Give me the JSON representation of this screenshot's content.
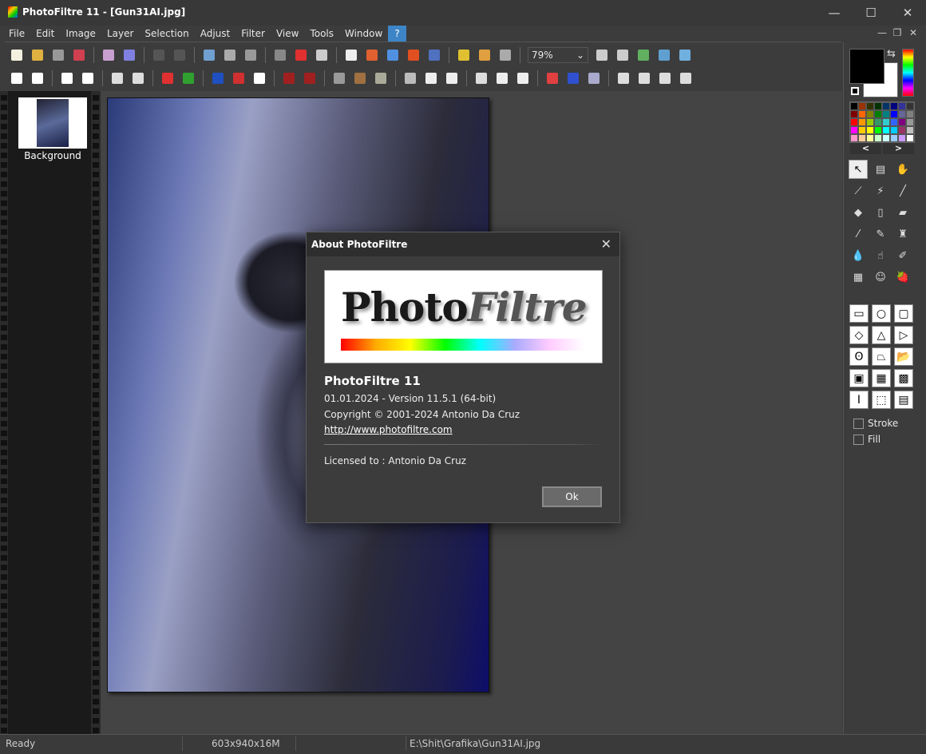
{
  "window": {
    "title": "PhotoFiltre 11 - [Gun31AI.jpg]",
    "minimize": "—",
    "maximize": "☐",
    "close": "✕"
  },
  "menu": [
    "File",
    "Edit",
    "Image",
    "Layer",
    "Selection",
    "Adjust",
    "Filter",
    "View",
    "Tools",
    "Window",
    "?"
  ],
  "mdi_controls": {
    "minimize": "—",
    "restore": "❐",
    "close": "✕"
  },
  "toolbar1": [
    {
      "icon": "new-file-icon",
      "color": "#f4f0e0"
    },
    {
      "icon": "open-folder-icon",
      "color": "#e0b040"
    },
    {
      "icon": "save-icon",
      "color": "#999"
    },
    {
      "icon": "save-as-icon",
      "color": "#d04050"
    },
    "|",
    {
      "icon": "print-icon",
      "color": "#c8a0d0"
    },
    {
      "icon": "scan-icon",
      "color": "#8080e0"
    },
    "|",
    {
      "icon": "undo-icon",
      "color": "#555"
    },
    {
      "icon": "redo-icon",
      "color": "#555"
    },
    "|",
    {
      "icon": "duplicate-image-icon",
      "color": "#70a0d0"
    },
    {
      "icon": "transparent-image-icon",
      "color": "#aaa"
    },
    {
      "icon": "paste-image-icon",
      "color": "#999"
    },
    "|",
    {
      "icon": "gradient-icon",
      "color": "#888"
    },
    {
      "icon": "color-grid-icon",
      "color": "#e03030"
    },
    {
      "icon": "transparency-icon",
      "color": "#ccc"
    },
    "|",
    {
      "icon": "crop-icon",
      "color": "#eee"
    },
    {
      "icon": "frame-icon",
      "color": "#e06030"
    },
    {
      "icon": "selection-icon",
      "color": "#5090e0"
    },
    {
      "icon": "text-icon",
      "color": "#e05020"
    },
    {
      "icon": "resize-icon",
      "color": "#5070c0"
    },
    "|",
    {
      "icon": "image-explorer-icon",
      "color": "#e0c030"
    },
    {
      "icon": "automate-icon",
      "color": "#e0a040"
    },
    {
      "icon": "batch-icon",
      "color": "#aaa"
    }
  ],
  "zoom": {
    "value": "79%",
    "arrow": "⌄"
  },
  "toolbar1b": [
    {
      "icon": "zoom-in-icon",
      "color": "#ccc"
    },
    {
      "icon": "zoom-out-icon",
      "color": "#ccc"
    },
    {
      "icon": "actual-size-icon",
      "color": "#60b060"
    },
    {
      "icon": "fit-window-icon",
      "color": "#60a0d0"
    },
    {
      "icon": "fullscreen-icon",
      "color": "#70b0e0"
    }
  ],
  "toolbar2": [
    {
      "icon": "brightness-minus-icon",
      "color": "#fff"
    },
    {
      "icon": "brightness-plus-icon",
      "color": "#fff"
    },
    "|",
    {
      "icon": "contrast-minus-icon",
      "color": "#fff"
    },
    {
      "icon": "contrast-plus-icon",
      "color": "#fff"
    },
    "|",
    {
      "icon": "gamma-minus-icon",
      "color": "#ddd"
    },
    {
      "icon": "gamma-plus-icon",
      "color": "#ddd"
    },
    "|",
    {
      "icon": "saturation-minus-icon",
      "color": "#e03030"
    },
    {
      "icon": "saturation-plus-icon",
      "color": "#30a030"
    },
    "|",
    {
      "icon": "levels-icon",
      "color": "#2050c0"
    },
    {
      "icon": "color-balance-icon",
      "color": "#d03030"
    },
    {
      "icon": "invert-icon",
      "color": "#fff"
    },
    "|",
    {
      "icon": "auto-gamma-icon",
      "color": "#a02020"
    },
    {
      "icon": "auto-contrast-icon",
      "color": "#a02020"
    },
    "|",
    {
      "icon": "blur-grid-icon",
      "color": "#999"
    },
    {
      "icon": "mosaic-icon",
      "color": "#a07040"
    },
    {
      "icon": "texture-icon",
      "color": "#aa9"
    },
    "|",
    {
      "icon": "soften-icon",
      "color": "#bbb"
    },
    {
      "icon": "drop-icon",
      "color": "#eee"
    },
    {
      "icon": "sharpen-icon",
      "color": "#eee"
    },
    "|",
    {
      "icon": "emboss-icon",
      "color": "#ddd"
    },
    {
      "icon": "cone-icon",
      "color": "#eee"
    },
    {
      "icon": "cone-plus-icon",
      "color": "#eee"
    },
    "|",
    {
      "icon": "rainbow-gradient-icon",
      "color": "#e04040"
    },
    {
      "icon": "blue-gradient-icon",
      "color": "#3050d0"
    },
    {
      "icon": "burst-icon",
      "color": "#aac"
    },
    "|",
    {
      "icon": "flip-horizontal-icon",
      "color": "#ddd"
    },
    {
      "icon": "flip-vertical-icon",
      "color": "#ddd"
    },
    {
      "icon": "rotate-left-icon",
      "color": "#ddd"
    },
    {
      "icon": "rotate-right-icon",
      "color": "#ddd"
    }
  ],
  "layers": [
    {
      "label": "Background"
    }
  ],
  "colors": {
    "foreground": "#000000",
    "background": "#FFFFFF"
  },
  "palette": [
    "#000000",
    "#993300",
    "#333300",
    "#003300",
    "#003366",
    "#000080",
    "#333399",
    "#333333",
    "#800000",
    "#FF6600",
    "#808000",
    "#008000",
    "#008080",
    "#0000FF",
    "#666699",
    "#808080",
    "#FF0000",
    "#FF9900",
    "#99CC00",
    "#339966",
    "#33CCCC",
    "#3366FF",
    "#800080",
    "#999999",
    "#FF00FF",
    "#FFCC00",
    "#FFFF00",
    "#00FF00",
    "#00FFFF",
    "#00CCFF",
    "#993366",
    "#C0C0C0",
    "#FF99CC",
    "#FFCC99",
    "#FFFF99",
    "#CCFFCC",
    "#CCFFFF",
    "#99CCFF",
    "#CC99FF",
    "#FFFFFF"
  ],
  "palette_nav": {
    "prev": "<",
    "next": ">"
  },
  "tools": [
    {
      "icon": "pointer-icon",
      "glyph": "↖",
      "selected": true
    },
    {
      "icon": "selection-tool-icon",
      "glyph": "▤"
    },
    {
      "icon": "hand-icon",
      "glyph": "✋"
    },
    {
      "icon": "eyedropper-icon",
      "glyph": "⟋"
    },
    {
      "icon": "magic-wand-icon",
      "glyph": "⚡"
    },
    {
      "icon": "line-icon",
      "glyph": "╱"
    },
    {
      "icon": "fill-bucket-icon",
      "glyph": "◆"
    },
    {
      "icon": "spray-icon",
      "glyph": "▯"
    },
    {
      "icon": "eraser-icon",
      "glyph": "▰"
    },
    {
      "icon": "brush-icon",
      "glyph": "⁄"
    },
    {
      "icon": "advanced-brush-icon",
      "glyph": "✎"
    },
    {
      "icon": "stamp-icon",
      "glyph": "♜"
    },
    {
      "icon": "blur-drop-icon",
      "glyph": "💧"
    },
    {
      "icon": "finger-icon",
      "glyph": "☝"
    },
    {
      "icon": "clone-brush-icon",
      "glyph": "✐"
    },
    {
      "icon": "pattern-icon",
      "glyph": "▦"
    },
    {
      "icon": "portrait-icon",
      "glyph": "☺"
    },
    {
      "icon": "strawberry-icon",
      "glyph": "🍓"
    }
  ],
  "shapes": [
    {
      "icon": "rectangle-icon",
      "glyph": "▭"
    },
    {
      "icon": "ellipse-icon",
      "glyph": "○"
    },
    {
      "icon": "rounded-rectangle-icon",
      "glyph": "▢"
    },
    {
      "icon": "diamond-icon",
      "glyph": "◇"
    },
    {
      "icon": "triangle-icon",
      "glyph": "△"
    },
    {
      "icon": "triangle-right-icon",
      "glyph": "▷"
    },
    {
      "icon": "lasso-icon",
      "glyph": "ʘ"
    },
    {
      "icon": "polygon-icon",
      "glyph": "⏢"
    },
    {
      "icon": "load-shape-icon",
      "glyph": "📂"
    },
    {
      "icon": "select-all-icon",
      "glyph": "▣"
    },
    {
      "icon": "select-43-icon",
      "glyph": "▦"
    },
    {
      "icon": "select-32-icon",
      "glyph": "▩"
    },
    {
      "icon": "text-selection-icon",
      "glyph": "Ⅰ"
    },
    {
      "icon": "crop-selection-icon",
      "glyph": "⬚"
    },
    {
      "icon": "window-selection-icon",
      "glyph": "▤"
    }
  ],
  "options": {
    "stroke": "Stroke",
    "fill": "Fill"
  },
  "status": {
    "state": "Ready",
    "dimensions": "603x940x16M",
    "path": "E:\\Shit\\Grafika\\Gun31AI.jpg"
  },
  "about": {
    "title": "About PhotoFiltre",
    "close": "✕",
    "logo_text_a": "Pho",
    "logo_text_b": "to",
    "logo_text_c": "Filtre",
    "name": "PhotoFiltre 11",
    "version": "01.01.2024 - Version 11.5.1 (64-bit)",
    "copyright": "Copyright © 2001-2024  Antonio Da Cruz",
    "url": "http://www.photofiltre.com",
    "license": "Licensed to : Antonio Da Cruz",
    "ok": "Ok"
  }
}
